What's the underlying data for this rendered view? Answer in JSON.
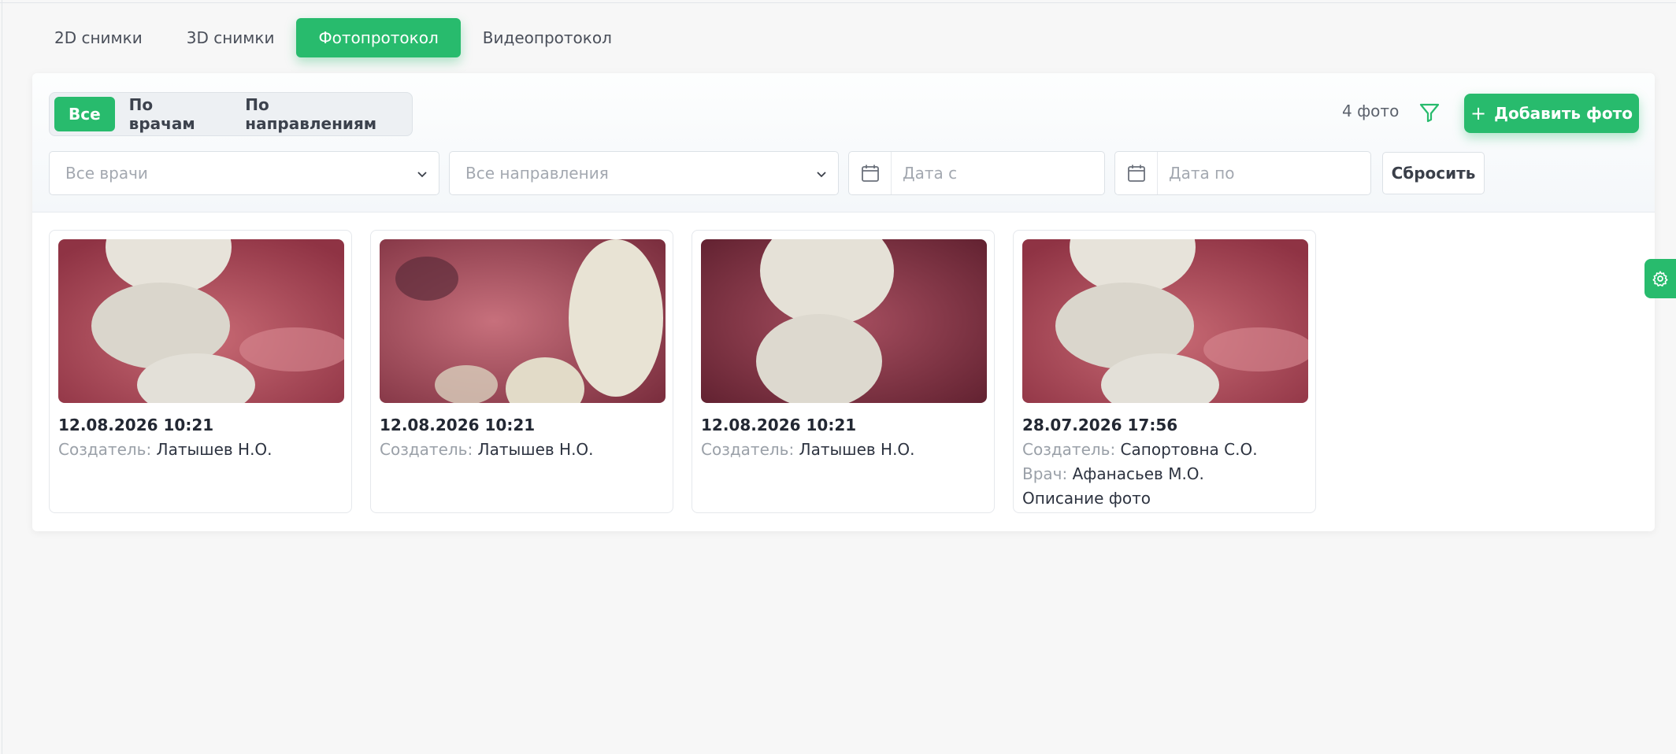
{
  "tabs": [
    {
      "label": "2D снимки",
      "active": false
    },
    {
      "label": "3D снимки",
      "active": false
    },
    {
      "label": "Фотопротокол",
      "active": true
    },
    {
      "label": "Видеопротокол",
      "active": false
    }
  ],
  "segment": {
    "items": [
      "Все",
      "По врачам",
      "По направлениям"
    ],
    "active": "Все"
  },
  "photo_count": "4 фото",
  "add_button_label": "Добавить фото",
  "filters": {
    "doctor_placeholder": "Все врачи",
    "direction_placeholder": "Все направления",
    "date_from_placeholder": "Дата с",
    "date_to_placeholder": "Дата по",
    "reset_label": "Сбросить"
  },
  "labels": {
    "creator": "Создатель:",
    "doctor": "Врач:"
  },
  "cards": [
    {
      "datetime": "12.08.2026 10:21",
      "creator": "Латышев Н.О.",
      "doctor": "",
      "description": "",
      "image": "teeth-photo-molars"
    },
    {
      "datetime": "12.08.2026 10:21",
      "creator": "Латышев Н.О.",
      "doctor": "",
      "description": "",
      "image": "teeth-photo-canine"
    },
    {
      "datetime": "12.08.2026 10:21",
      "creator": "Латышев Н.О.",
      "doctor": "",
      "description": "",
      "image": "teeth-photo-premolars"
    },
    {
      "datetime": "28.07.2026 17:56",
      "creator": "Сапортовна С.О.",
      "doctor": "Афанасьев М.О.",
      "description": "Описание фото",
      "image": "teeth-photo-molars"
    }
  ],
  "colors": {
    "accent": "#28bb6d",
    "background": "#f7f7f7"
  },
  "icons": {
    "filter": "filter-funnel-icon",
    "plus": "plus-icon",
    "calendar": "calendar-icon",
    "chevron": "chevron-down-icon",
    "settings": "gear-icon"
  }
}
